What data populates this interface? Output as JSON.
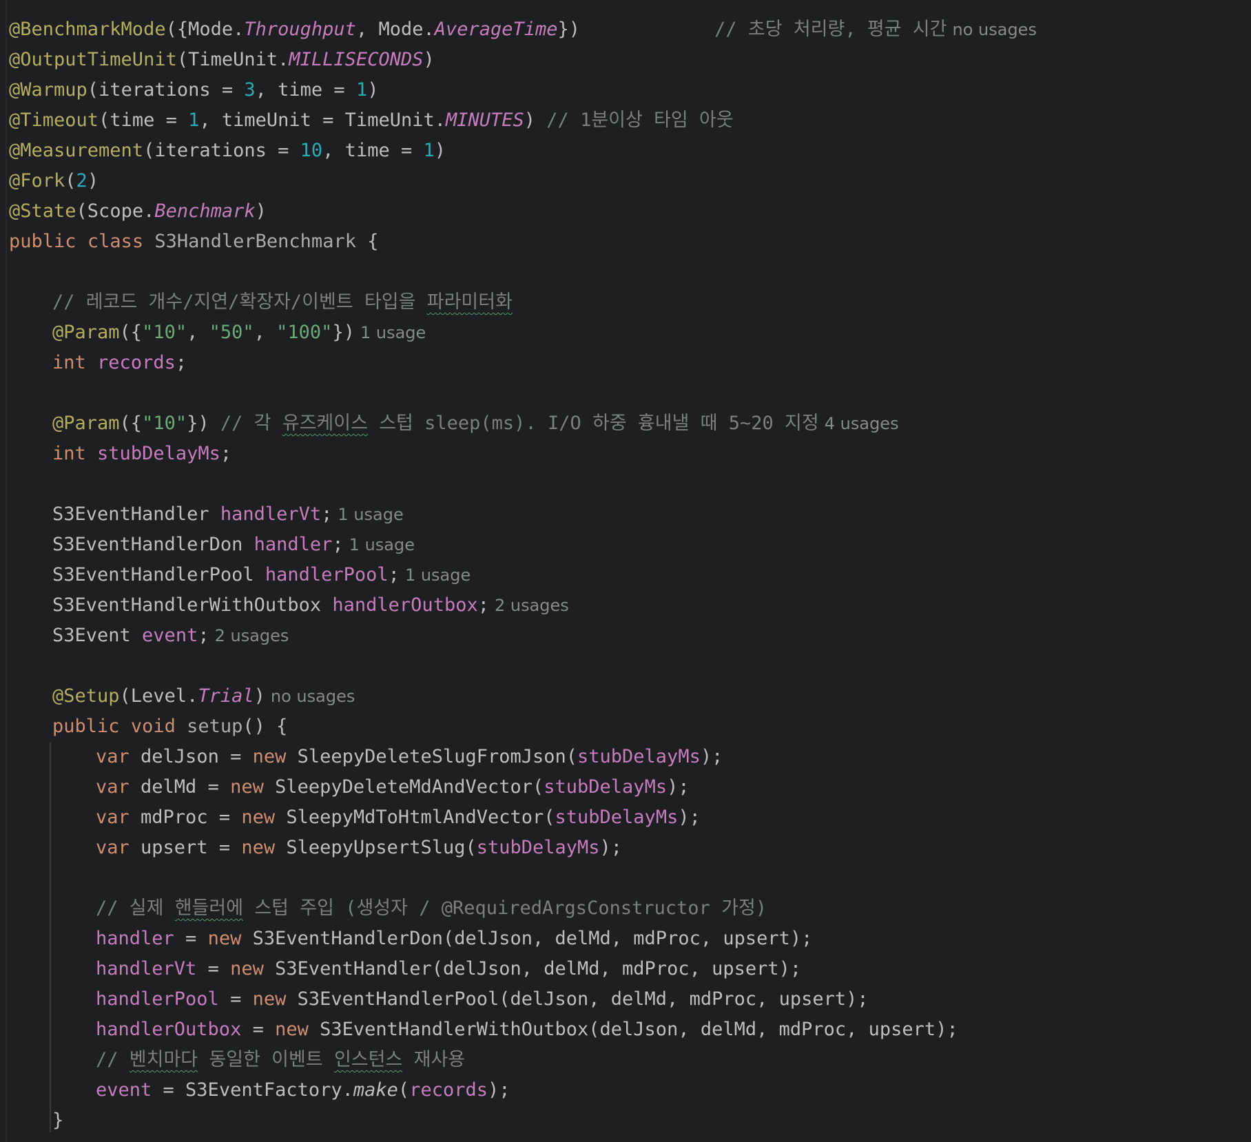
{
  "colors": {
    "background": "#1e1f22",
    "annotation": "#b3ae60",
    "keyword": "#cf8e6d",
    "number": "#2aacb8",
    "string": "#6aab73",
    "field": "#c77dbb",
    "comment": "#7a7e85",
    "text": "#bcbec4",
    "usage_hint": "#868991"
  },
  "code": {
    "l1": {
      "ann": "@BenchmarkMode",
      "open": "({Mode.",
      "c1": "Throughput",
      "mid": ", Mode.",
      "c2": "AverageTime",
      "close": "})",
      "pad": "            ",
      "comment": "// 초당 처리량, 평균 시간",
      "hint": "no usages"
    },
    "l2": {
      "ann": "@OutputTimeUnit",
      "open": "(TimeUnit.",
      "c1": "MILLISECONDS",
      "close": ")"
    },
    "l3": {
      "ann": "@Warmup",
      "a": "(iterations = ",
      "n1": "3",
      "b": ", time = ",
      "n2": "1",
      "close": ")"
    },
    "l4": {
      "ann": "@Timeout",
      "a": "(time = ",
      "n1": "1",
      "b": ", timeUnit = TimeUnit.",
      "c1": "MINUTES",
      "close": ") ",
      "comment": "// 1분이상 타임 아웃"
    },
    "l5": {
      "ann": "@Measurement",
      "a": "(iterations = ",
      "n1": "10",
      "b": ", time = ",
      "n2": "1",
      "close": ")"
    },
    "l6": {
      "ann": "@Fork",
      "a": "(",
      "n1": "2",
      "close": ")"
    },
    "l7": {
      "ann": "@State",
      "open": "(Scope.",
      "c1": "Benchmark",
      "close": ")"
    },
    "l8": {
      "kw1": "public",
      "kw2": "class",
      "name": "S3HandlerBenchmark",
      "brace": " {"
    },
    "l10": {
      "comment_a": "// 레코드 개수/지연/확장자/이벤트 타입을 ",
      "comment_typo": "파라미터화"
    },
    "l11": {
      "ann": "@Param",
      "open": "({",
      "s1": "\"10\"",
      "sep1": ", ",
      "s2": "\"50\"",
      "sep2": ", ",
      "s3": "\"100\"",
      "close": "})",
      "hint": "1 usage"
    },
    "l12": {
      "kw": "int",
      "field": "records",
      "semi": ";"
    },
    "l14": {
      "ann": "@Param",
      "open": "({",
      "s1": "\"10\"",
      "close": "}) ",
      "comment_a": "// 각 ",
      "comment_typo": "유즈케이스",
      "comment_b": " 스텁 sleep(ms). I/O 하중 흉내낼 때 5~20 지정",
      "hint": "4 usages"
    },
    "l15": {
      "kw": "int",
      "field": "stubDelayMs",
      "semi": ";"
    },
    "l17": {
      "type": "S3EventHandler ",
      "field": "handlerVt",
      "semi": ";",
      "hint": "1 usage"
    },
    "l18": {
      "type": "S3EventHandlerDon ",
      "field": "handler",
      "semi": ";",
      "hint": "1 usage"
    },
    "l19": {
      "type": "S3EventHandlerPool ",
      "field": "handlerPool",
      "semi": ";",
      "hint": "1 usage"
    },
    "l20": {
      "type": "S3EventHandlerWithOutbox ",
      "field": "handlerOutbox",
      "semi": ";",
      "hint": "2 usages"
    },
    "l21": {
      "type": "S3Event ",
      "field": "event",
      "semi": ";",
      "hint": "2 usages"
    },
    "l23": {
      "ann": "@Setup",
      "open": "(Level.",
      "c1": "Trial",
      "close": ")",
      "hint": "no usages"
    },
    "l24": {
      "kw1": "public",
      "kw2": "void",
      "name": "setup",
      "rest": "() {"
    },
    "l25": {
      "kw": "var",
      "a": " delJson = ",
      "kw2": "new",
      "b": " SleepyDeleteSlugFromJson(",
      "field": "stubDelayMs",
      "close": ");"
    },
    "l26": {
      "kw": "var",
      "a": " delMd = ",
      "kw2": "new",
      "b": " SleepyDeleteMdAndVector(",
      "field": "stubDelayMs",
      "close": ");"
    },
    "l27": {
      "kw": "var",
      "a": " mdProc = ",
      "kw2": "new",
      "b": " SleepyMdToHtmlAndVector(",
      "field": "stubDelayMs",
      "close": ");"
    },
    "l28": {
      "kw": "var",
      "a": " upsert = ",
      "kw2": "new",
      "b": " SleepyUpsertSlug(",
      "field": "stubDelayMs",
      "close": ");"
    },
    "l30": {
      "comment_a": "// 실제 ",
      "comment_typo": "핸들러에",
      "comment_b": " 스텁 주입 (생성자 / @RequiredArgsConstructor 가정)"
    },
    "l31": {
      "field": "handler",
      "a": " = ",
      "kw": "new",
      "b": " S3EventHandlerDon(delJson, delMd, mdProc, upsert);"
    },
    "l32": {
      "field": "handlerVt",
      "a": " = ",
      "kw": "new",
      "b": " S3EventHandler(delJson, delMd, mdProc, upsert);"
    },
    "l33": {
      "field": "handlerPool",
      "a": " = ",
      "kw": "new",
      "b": " S3EventHandlerPool(delJson, delMd, mdProc, upsert);"
    },
    "l34": {
      "field": "handlerOutbox",
      "a": " = ",
      "kw": "new",
      "b": " S3EventHandlerWithOutbox(delJson, delMd, mdProc, upsert);"
    },
    "l35": {
      "comment_a": "// ",
      "comment_typo1": "벤치마다",
      "comment_b": " 동일한 이벤트 ",
      "comment_typo2": "인스턴스",
      "comment_c": " 재사용"
    },
    "l36": {
      "field": "event",
      "a": " = S3EventFactory.",
      "call": "make",
      "b": "(",
      "field2": "records",
      "close": ");"
    },
    "l37": {
      "brace": "}"
    }
  }
}
